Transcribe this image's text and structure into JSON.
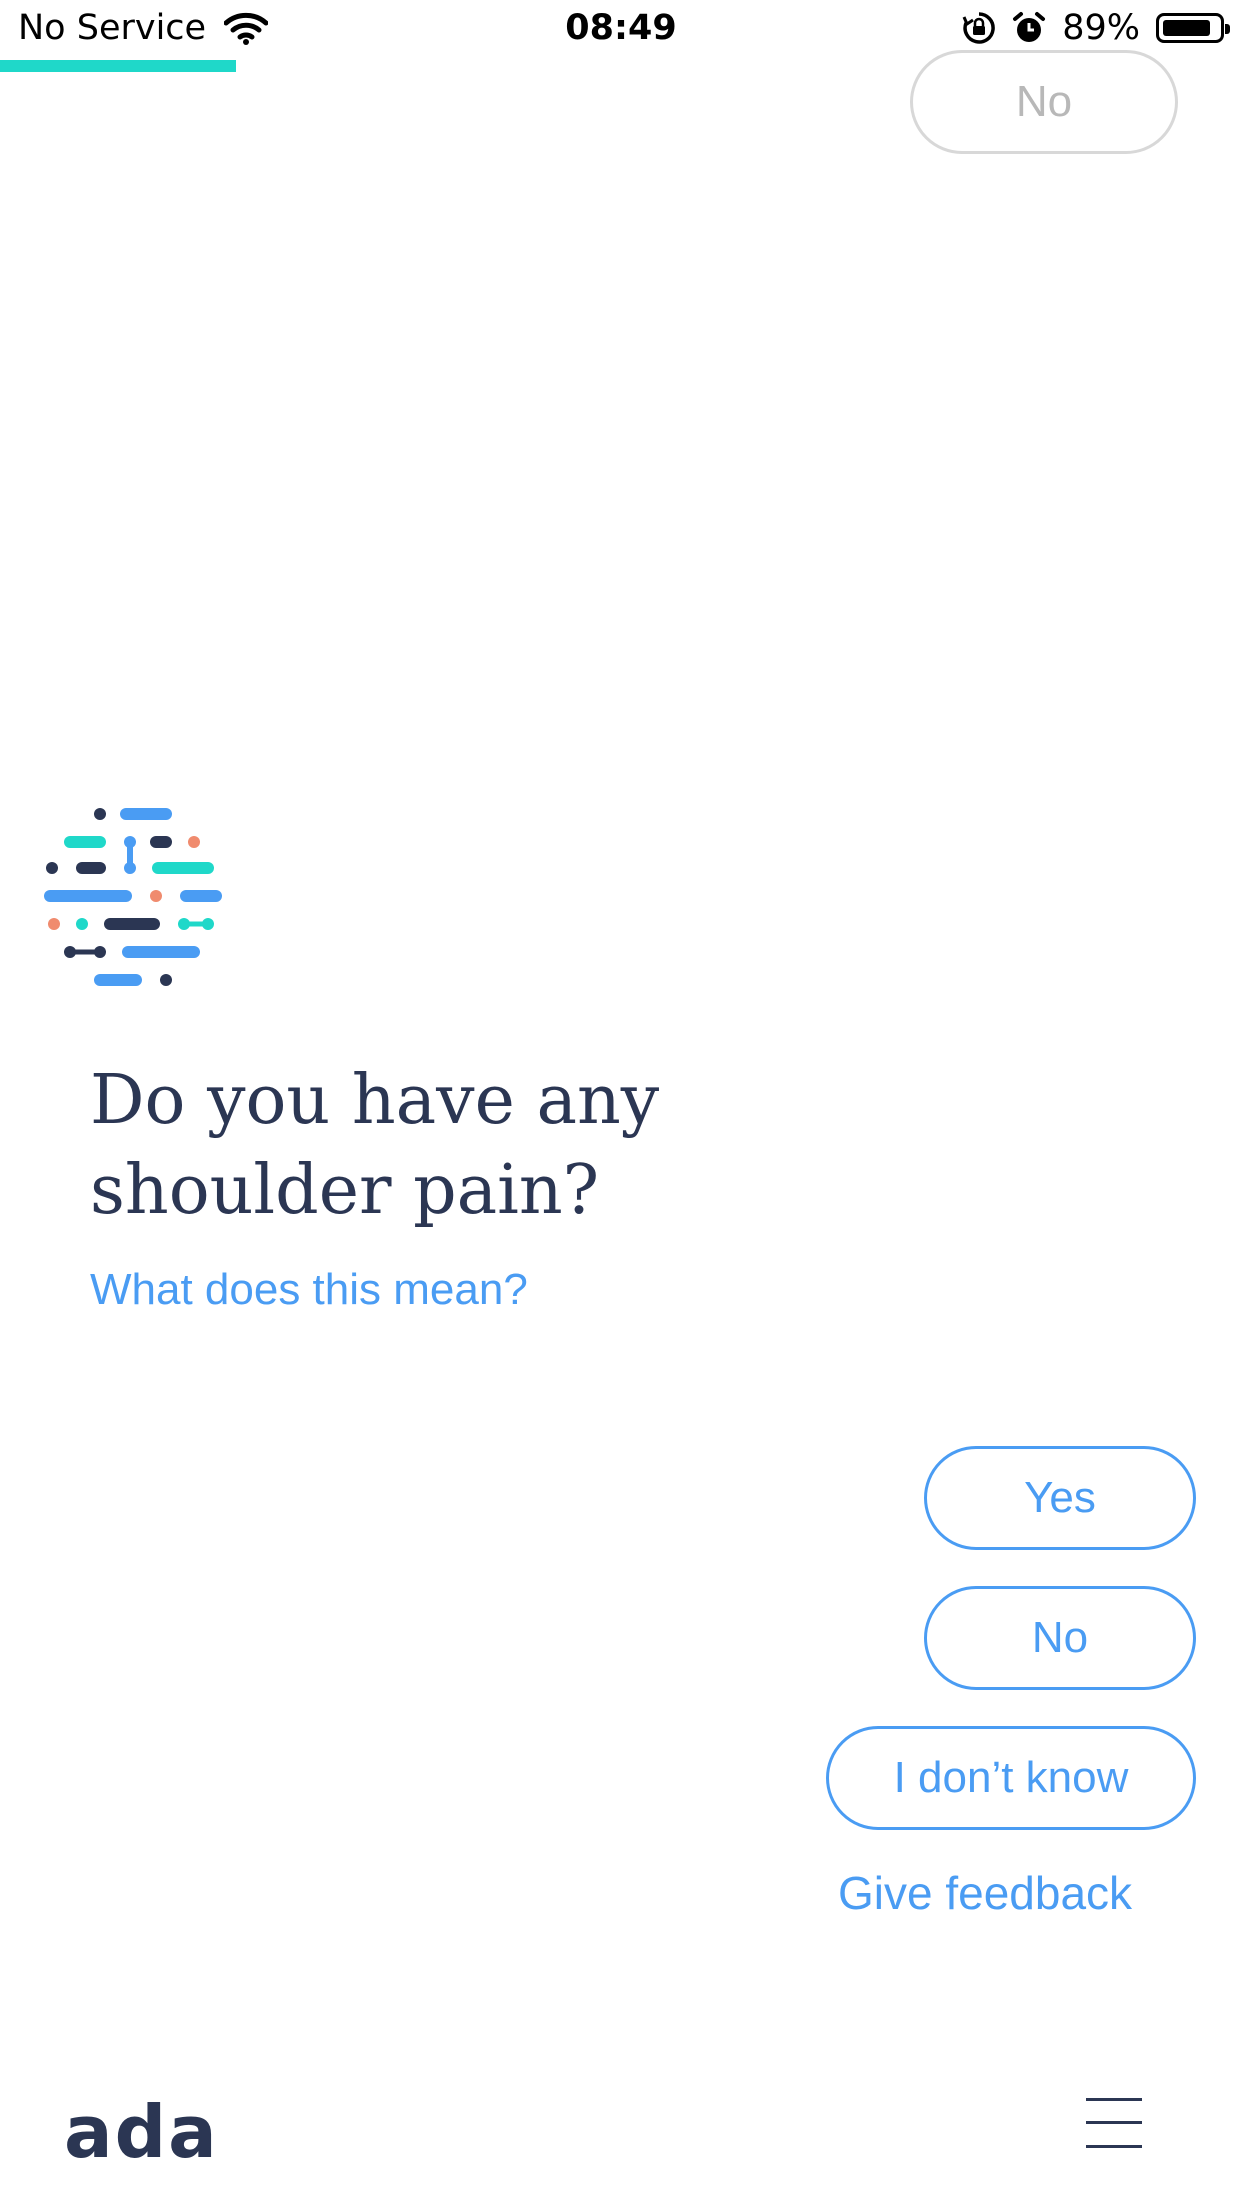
{
  "status_bar": {
    "carrier": "No Service",
    "time": "08:49",
    "battery_percent": "89%",
    "battery_level": 0.89,
    "icons": [
      "wifi-icon",
      "rotation-lock-icon",
      "alarm-icon",
      "battery-icon"
    ]
  },
  "progress": {
    "fraction": 0.19,
    "color": "#1fd8c9"
  },
  "previous_answer": {
    "label": "No"
  },
  "question": {
    "text": "Do you have any shoulder pain?",
    "help_link": "What does this mean?"
  },
  "answers": [
    {
      "label": "Yes"
    },
    {
      "label": "No"
    },
    {
      "label": "I don’t know"
    }
  ],
  "feedback_link": "Give feedback",
  "footer": {
    "brand": "ada",
    "menu_icon": "hamburger-menu-icon"
  },
  "colors": {
    "accent": "#4a9cf3",
    "text_dark": "#2b3653",
    "teal": "#1fd8c9",
    "orange": "#f08b6e"
  }
}
